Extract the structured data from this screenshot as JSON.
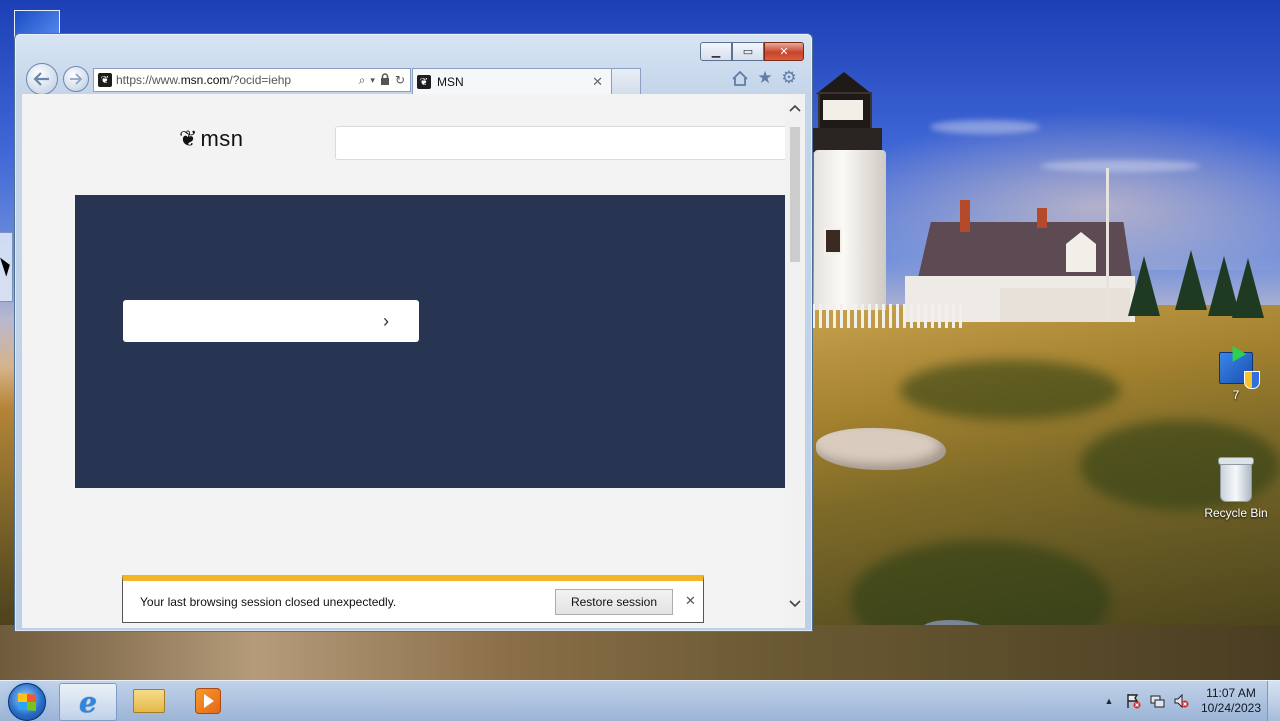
{
  "browser": {
    "address": {
      "url_prefix": "https://www.",
      "url_domain": "msn.com",
      "url_suffix": "/?ocid=iehp"
    },
    "tab": {
      "title": "MSN",
      "close_label": "✕"
    },
    "window_buttons": {
      "minimize": "▁",
      "maximize": "▭",
      "close": "✕"
    },
    "icons": [
      "back-icon",
      "forward-icon",
      "search-icon",
      "dropdown-icon",
      "lock-icon",
      "refresh-icon",
      "home-icon",
      "favorites-star-icon",
      "settings-gear-icon"
    ]
  },
  "page": {
    "logo_text": "msn",
    "hero": {
      "accent_color": "#283552",
      "button_chevron": "›"
    },
    "notification": {
      "message": "Your last browsing session closed unexpectedly.",
      "restore_label": "Restore session",
      "close_label": "✕",
      "accent_color": "#f3b425"
    }
  },
  "desktop": {
    "icons": [
      {
        "label": "7",
        "icon": "windows-update-icon"
      },
      {
        "label": "Recycle Bin",
        "icon": "recycle-bin-icon"
      }
    ]
  },
  "taskbar": {
    "apps": [
      "internet-explorer-icon",
      "file-explorer-icon",
      "media-player-icon"
    ],
    "tray_expand": "▲",
    "clock": {
      "time": "11:07 AM",
      "date": "10/24/2023"
    }
  }
}
